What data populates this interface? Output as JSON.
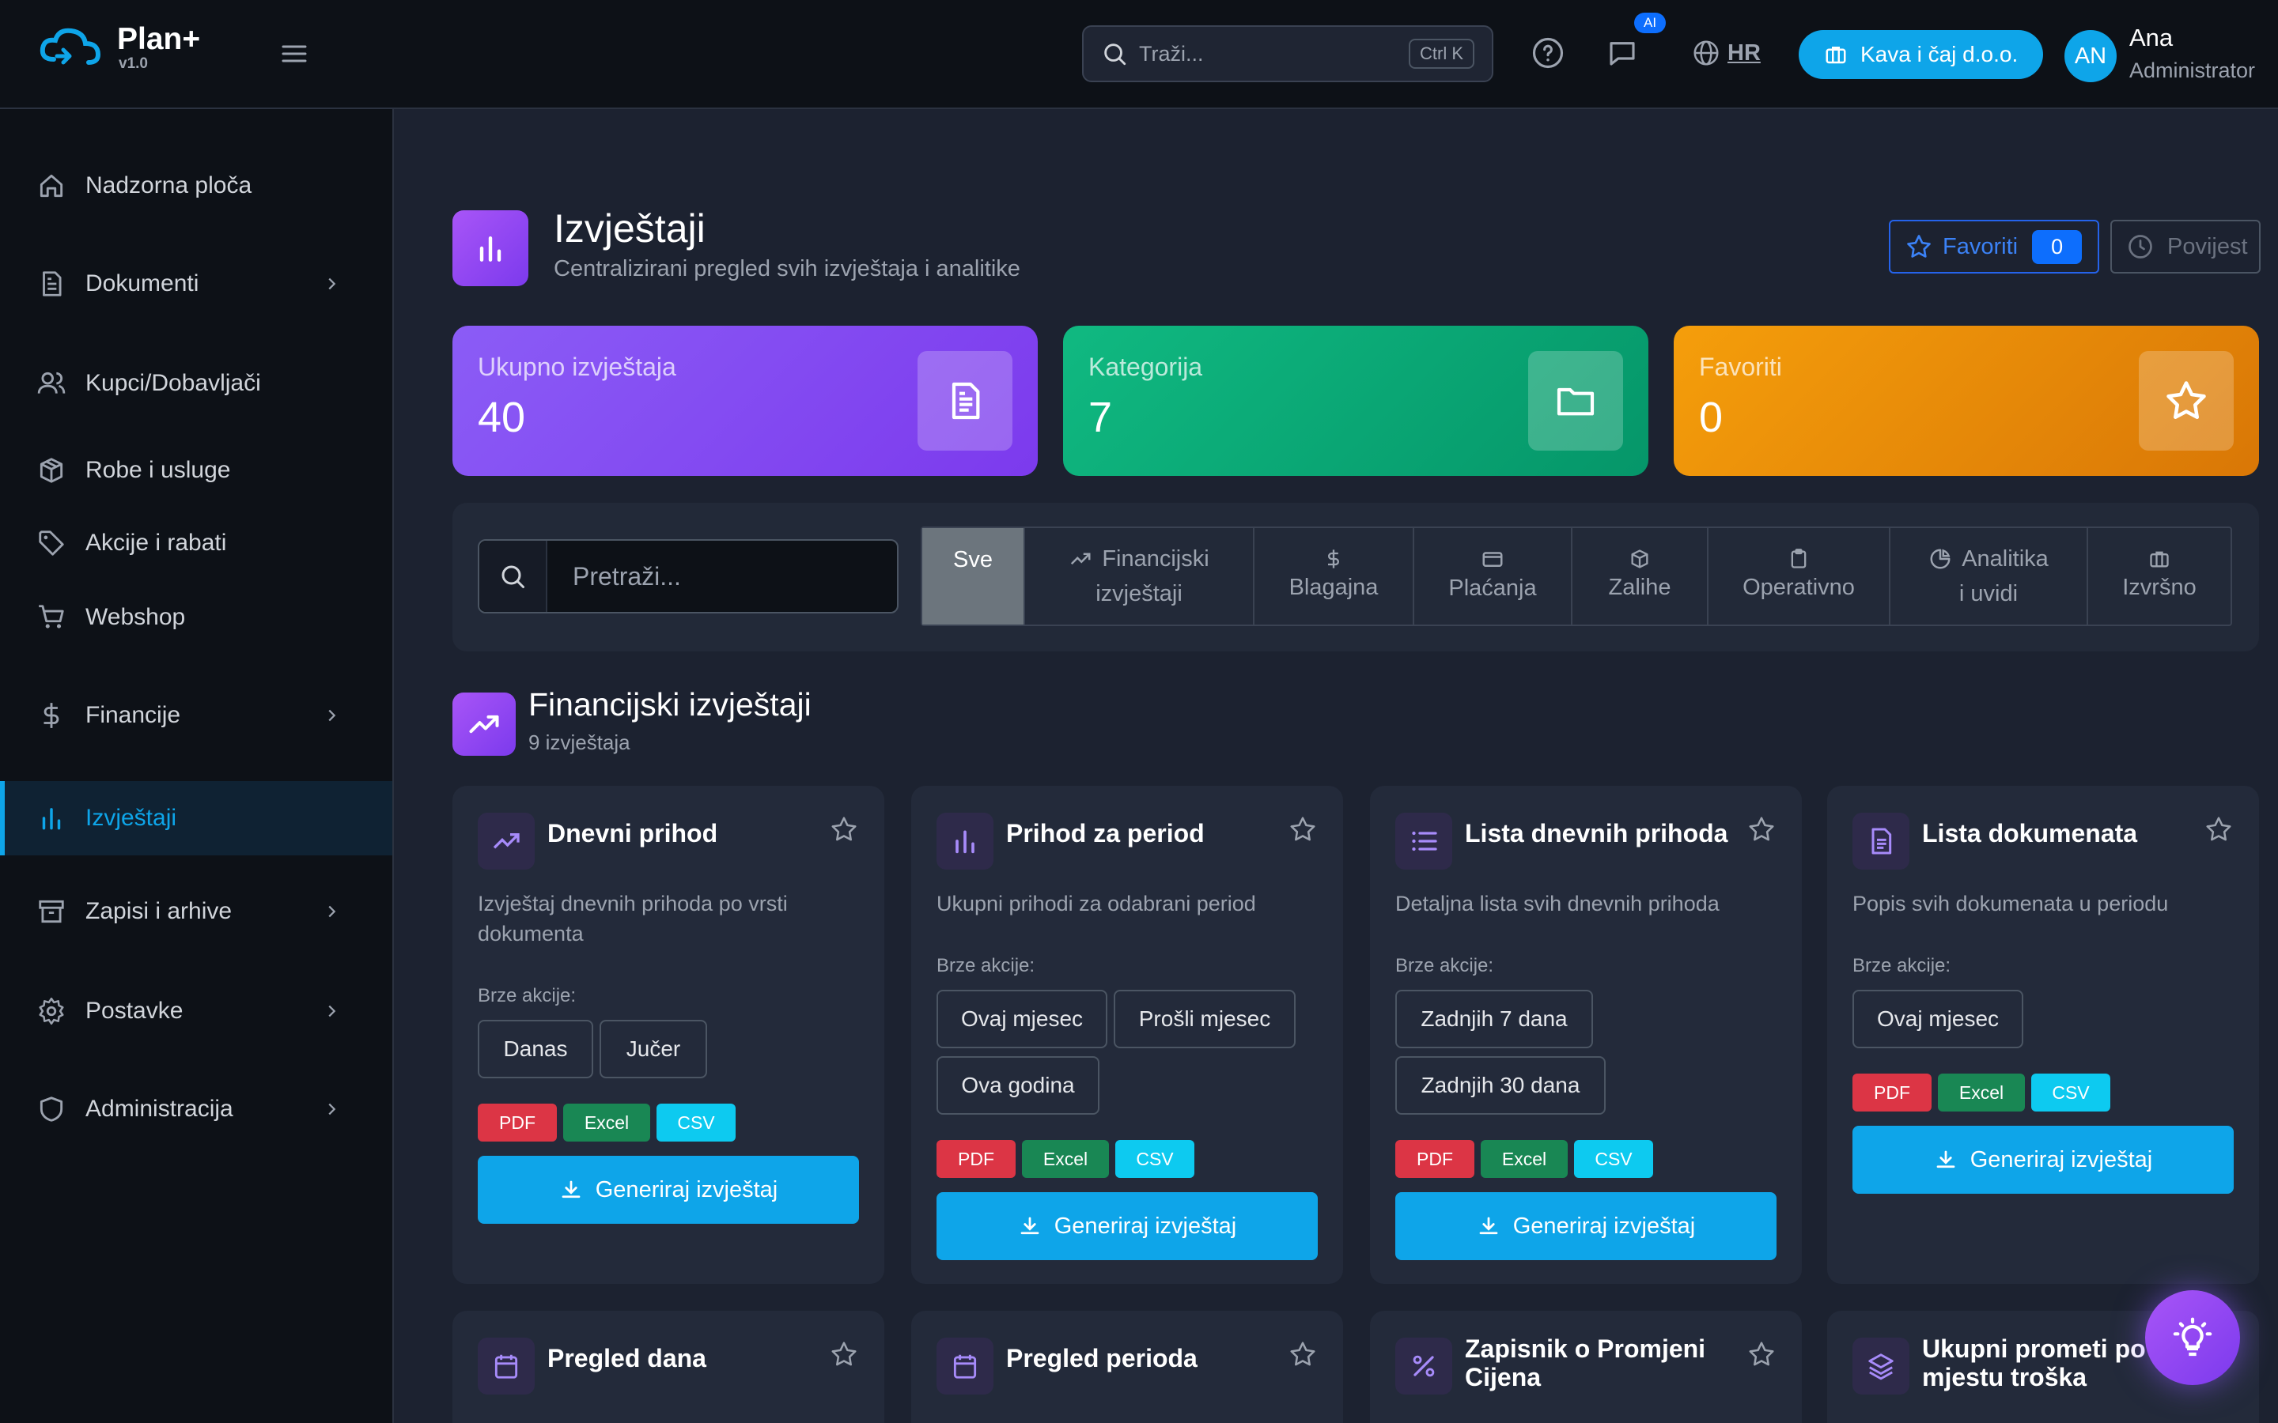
{
  "topbar": {
    "app_name": "Plan+",
    "version": "v1.0",
    "search_placeholder": "Traži...",
    "search_shortcut": "Ctrl K",
    "ai_badge": "AI",
    "language": "HR",
    "company": "Kava i čaj d.o.o.",
    "user_initials": "AN",
    "user_name": "Ana",
    "user_role": "Administrator"
  },
  "sidebar": {
    "items": [
      {
        "label": "Nadzorna ploča",
        "icon": "home-icon",
        "chevron": false
      },
      {
        "label": "Dokumenti",
        "icon": "file-icon",
        "chevron": true
      },
      {
        "label": "Kupci/Dobavljači",
        "icon": "users-icon",
        "chevron": false
      },
      {
        "label": "Robe i usluge",
        "icon": "box-icon",
        "chevron": false
      },
      {
        "label": "Akcije i rabati",
        "icon": "tag-icon",
        "chevron": false
      },
      {
        "label": "Webshop",
        "icon": "cart-icon",
        "chevron": false
      },
      {
        "label": "Financije",
        "icon": "dollar-icon",
        "chevron": true
      },
      {
        "label": "Izvještaji",
        "icon": "bar-chart-icon",
        "chevron": false,
        "active": true
      },
      {
        "label": "Zapisi i arhive",
        "icon": "archive-icon",
        "chevron": true
      },
      {
        "label": "Postavke",
        "icon": "gear-icon",
        "chevron": true
      },
      {
        "label": "Administracija",
        "icon": "shield-icon",
        "chevron": true
      }
    ]
  },
  "header": {
    "title": "Izvještaji",
    "subtitle": "Centralizirani pregled svih izvještaja i analitike",
    "favorites_label": "Favoriti",
    "favorites_count": "0",
    "history_label": "Povijest"
  },
  "stats": [
    {
      "label": "Ukupno izvještaja",
      "value": "40",
      "icon": "document-icon",
      "color": "#8b5cf6"
    },
    {
      "label": "Kategorija",
      "value": "7",
      "icon": "folder-icon",
      "color": "#10b981"
    },
    {
      "label": "Favoriti",
      "value": "0",
      "icon": "star-icon",
      "color": "#f59e0b"
    }
  ],
  "filter": {
    "search_placeholder": "Pretraži...",
    "tabs": [
      {
        "line1": "Sve",
        "line2": ""
      },
      {
        "line1": "Financijski",
        "line2": "izvještaji"
      },
      {
        "line1": "",
        "line2": "Blagajna"
      },
      {
        "line1": "",
        "line2": "Plaćanja"
      },
      {
        "line1": "",
        "line2": "Zalihe"
      },
      {
        "line1": "",
        "line2": "Operativno"
      },
      {
        "line1": "Analitika",
        "line2": "i uvidi"
      },
      {
        "line1": "",
        "line2": "Izvršno"
      }
    ]
  },
  "section": {
    "title": "Financijski izvještaji",
    "count": "9 izvještaja"
  },
  "quick_actions_label": "Brze akcije:",
  "formats": [
    "PDF",
    "Excel",
    "CSV"
  ],
  "generate_label": "Generiraj izvještaj",
  "cards": [
    {
      "title": "Dnevni prihod",
      "icon": "trending-up-icon",
      "desc": "Izvještaj dnevnih prihoda po vrsti dokumenta",
      "actions": [
        "Danas",
        "Jučer"
      ]
    },
    {
      "title": "Prihod za period",
      "icon": "bar-chart-icon",
      "desc": "Ukupni prihodi za odabrani period",
      "actions": [
        "Ovaj mjesec",
        "Prošli mjesec",
        "Ova godina"
      ]
    },
    {
      "title": "Lista dnevnih prihoda",
      "icon": "list-icon",
      "desc": "Detaljna lista svih dnevnih prihoda",
      "actions": [
        "Zadnjih 7 dana",
        "Zadnjih 30 dana"
      ]
    },
    {
      "title": "Lista dokumenata",
      "icon": "file-text-icon",
      "desc": "Popis svih dokumenata u periodu",
      "actions": [
        "Ovaj mjesec"
      ]
    },
    {
      "title": "Pregled dana",
      "icon": "calendar-icon"
    },
    {
      "title": "Pregled perioda",
      "icon": "calendar-icon"
    },
    {
      "title": "Zapisnik o Promjeni Cijena",
      "icon": "percent-icon"
    },
    {
      "title": "Ukupni prometi po mjestu troška",
      "icon": "layers-icon"
    }
  ],
  "colors": {
    "accent": "#0ea5e9",
    "pdf": "#dc3545",
    "excel": "#198754",
    "csv": "#0dcaf0",
    "purple": "#8b5cf6"
  }
}
